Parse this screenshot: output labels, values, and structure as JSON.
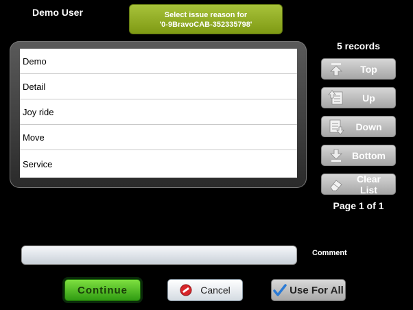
{
  "header": {
    "user": "Demo User",
    "banner_line1": "Select issue reason for",
    "banner_line2": "'0-9BravoCAB-352335798'",
    "records": "5 records"
  },
  "list": {
    "items": [
      "Demo",
      "Detail",
      "Joy ride",
      "Move",
      "Service"
    ]
  },
  "nav": {
    "top": "Top",
    "up": "Up",
    "down": "Down",
    "bottom": "Bottom",
    "clear": "Clear List",
    "page": "Page 1 of 1"
  },
  "comment": {
    "label": "Comment",
    "value": "",
    "placeholder": ""
  },
  "actions": {
    "continue": "Continue",
    "cancel": "Cancel",
    "use_for_all": "Use For All"
  },
  "icons": {
    "top": "arrow-up-bar-icon",
    "up": "arrow-up-page-icon",
    "down": "arrow-down-page-icon",
    "bottom": "arrow-down-bar-icon",
    "clear": "eraser-icon",
    "cancel": "no-entry-icon",
    "use_for_all": "checkmark-icon"
  },
  "colors": {
    "banner": "#8aa31e",
    "continue": "#45b21a",
    "nav_disabled": "#b8b8b8"
  }
}
